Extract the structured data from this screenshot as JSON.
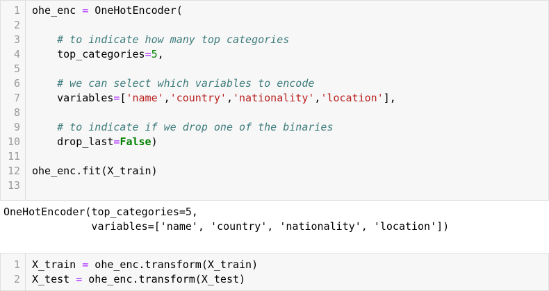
{
  "cell1": {
    "lines": [
      {
        "n": "1",
        "parts": [
          {
            "t": "ohe_enc ",
            "c": ""
          },
          {
            "t": "=",
            "c": "op"
          },
          {
            "t": " OneHotEncoder(",
            "c": ""
          }
        ]
      },
      {
        "n": "2",
        "parts": []
      },
      {
        "n": "3",
        "parts": [
          {
            "t": "    # to indicate how many top categories",
            "c": "cm"
          }
        ]
      },
      {
        "n": "4",
        "parts": [
          {
            "t": "    top_categories",
            "c": ""
          },
          {
            "t": "=",
            "c": "op"
          },
          {
            "t": "5",
            "c": "num"
          },
          {
            "t": ",",
            "c": ""
          }
        ]
      },
      {
        "n": "5",
        "parts": []
      },
      {
        "n": "6",
        "parts": [
          {
            "t": "    # we can select which variables to encode",
            "c": "cm"
          }
        ]
      },
      {
        "n": "7",
        "parts": [
          {
            "t": "    variables",
            "c": ""
          },
          {
            "t": "=",
            "c": "op"
          },
          {
            "t": "[",
            "c": ""
          },
          {
            "t": "'name'",
            "c": "str"
          },
          {
            "t": ",",
            "c": ""
          },
          {
            "t": "'country'",
            "c": "str"
          },
          {
            "t": ",",
            "c": ""
          },
          {
            "t": "'nationality'",
            "c": "str"
          },
          {
            "t": ",",
            "c": ""
          },
          {
            "t": "'location'",
            "c": "str"
          },
          {
            "t": "],",
            "c": ""
          }
        ]
      },
      {
        "n": "8",
        "parts": []
      },
      {
        "n": "9",
        "parts": [
          {
            "t": "    # to indicate if we drop one of the binaries",
            "c": "cm"
          }
        ]
      },
      {
        "n": "10",
        "parts": [
          {
            "t": "    drop_last",
            "c": ""
          },
          {
            "t": "=",
            "c": "op"
          },
          {
            "t": "False",
            "c": "kw"
          },
          {
            "t": ")",
            "c": ""
          }
        ]
      },
      {
        "n": "11",
        "parts": []
      },
      {
        "n": "12",
        "parts": [
          {
            "t": "ohe_enc.fit(X_train)",
            "c": ""
          }
        ]
      },
      {
        "n": "13",
        "parts": []
      }
    ]
  },
  "output": {
    "lines": [
      "OneHotEncoder(top_categories=5,",
      "              variables=['name', 'country', 'nationality', 'location'])"
    ]
  },
  "cell2": {
    "lines": [
      {
        "n": "1",
        "parts": [
          {
            "t": "X_train ",
            "c": ""
          },
          {
            "t": "=",
            "c": "op"
          },
          {
            "t": " ohe_enc.transform(X_train)",
            "c": ""
          }
        ]
      },
      {
        "n": "2",
        "parts": [
          {
            "t": "X_test ",
            "c": ""
          },
          {
            "t": "=",
            "c": "op"
          },
          {
            "t": " ohe_enc.transform(X_test)",
            "c": ""
          }
        ]
      }
    ]
  }
}
